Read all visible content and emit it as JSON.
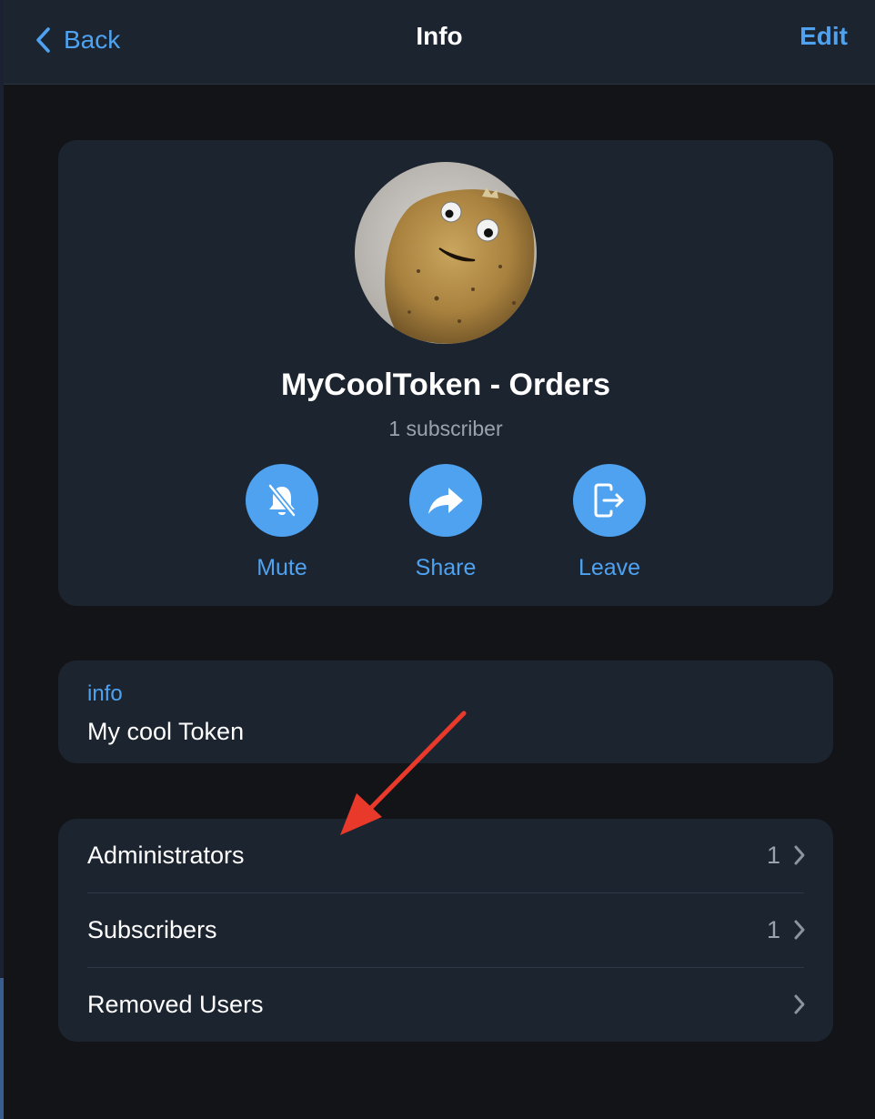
{
  "header": {
    "back_label": "Back",
    "title": "Info",
    "edit_label": "Edit"
  },
  "profile": {
    "name": "MyCoolToken - Orders",
    "subscribers_text": "1 subscriber",
    "avatar": "potato-with-googly-eyes"
  },
  "actions": [
    {
      "label": "Mute",
      "icon": "bell-muted-icon"
    },
    {
      "label": "Share",
      "icon": "share-arrow-icon"
    },
    {
      "label": "Leave",
      "icon": "leave-icon"
    }
  ],
  "info": {
    "label": "info",
    "value": "My cool Token"
  },
  "list": [
    {
      "label": "Administrators",
      "count": "1"
    },
    {
      "label": "Subscribers",
      "count": "1"
    },
    {
      "label": "Removed Users",
      "count": ""
    }
  ],
  "colors": {
    "accent": "#4ea2f0",
    "background": "#121418",
    "card": "#1c2430",
    "annotation_arrow": "#e8392b"
  }
}
